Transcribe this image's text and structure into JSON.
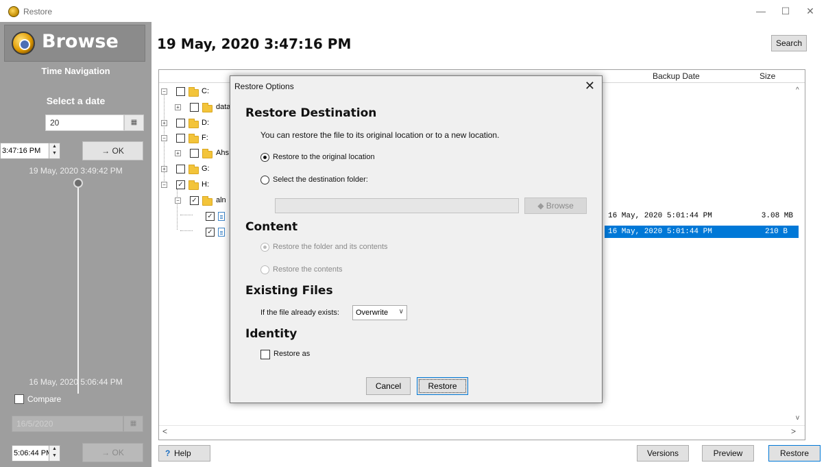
{
  "window": {
    "title": "Restore",
    "minimize": "—",
    "maximize": "☐",
    "close": "✕"
  },
  "left_panel": {
    "header": "Browse",
    "time_navigation": "Time Navigation",
    "select_date_label": "Select a date",
    "date_value": "20",
    "time_value": "3:47:16 PM",
    "ok_label": "→ OK",
    "slider_top_label": "19 May, 2020 3:49:42 PM",
    "slider_bottom_label": "16 May, 2020 5:06:44 PM",
    "compare_label": "Compare",
    "compare_date_value": "16/5/2020",
    "compare_time_value": "5:06:44 PM",
    "compare_ok_label": "→ OK"
  },
  "header": {
    "date_title": "19 May, 2020 3:47:16 PM",
    "search_label": "Search"
  },
  "file_panel": {
    "columns": [
      "Backup Date",
      "Size"
    ],
    "tree": [
      {
        "label": "C:",
        "checked": false
      },
      {
        "label": "data",
        "checked": false
      },
      {
        "label": "D:",
        "checked": false
      },
      {
        "label": "F:",
        "checked": false
      },
      {
        "label": "Ahs",
        "checked": false
      },
      {
        "label": "G:",
        "checked": false
      },
      {
        "label": "H:",
        "checked": true
      },
      {
        "label": "aln",
        "checked": true
      }
    ],
    "files": [
      {
        "backup_date": "16 May, 2020 5:01:44 PM",
        "size": "3.08 MB",
        "selected": false
      },
      {
        "backup_date": "16 May, 2020 5:01:44 PM",
        "size": "210 B",
        "selected": true
      }
    ]
  },
  "footer": {
    "help_label": "Help",
    "versions_label": "Versions",
    "preview_label": "Preview",
    "restore_label": "Restore"
  },
  "dialog": {
    "title": "Restore Options",
    "restore_destination_heading": "Restore Destination",
    "restore_destination_desc": "You can restore the file to its original location or to a new location.",
    "option_original": "Restore to the original location",
    "option_select_folder": "Select the destination folder:",
    "destination_value": "",
    "browse_label": "Browse",
    "content_heading": "Content",
    "option_folder_contents": "Restore the folder and its contents",
    "option_contents": "Restore the contents",
    "existing_files_heading": "Existing Files",
    "existing_prompt": "If the file already exists:",
    "existing_value": "Overwrite",
    "identity_heading": "Identity",
    "restore_as_label": "Restore as",
    "cancel_label": "Cancel",
    "restore_label": "Restore"
  }
}
